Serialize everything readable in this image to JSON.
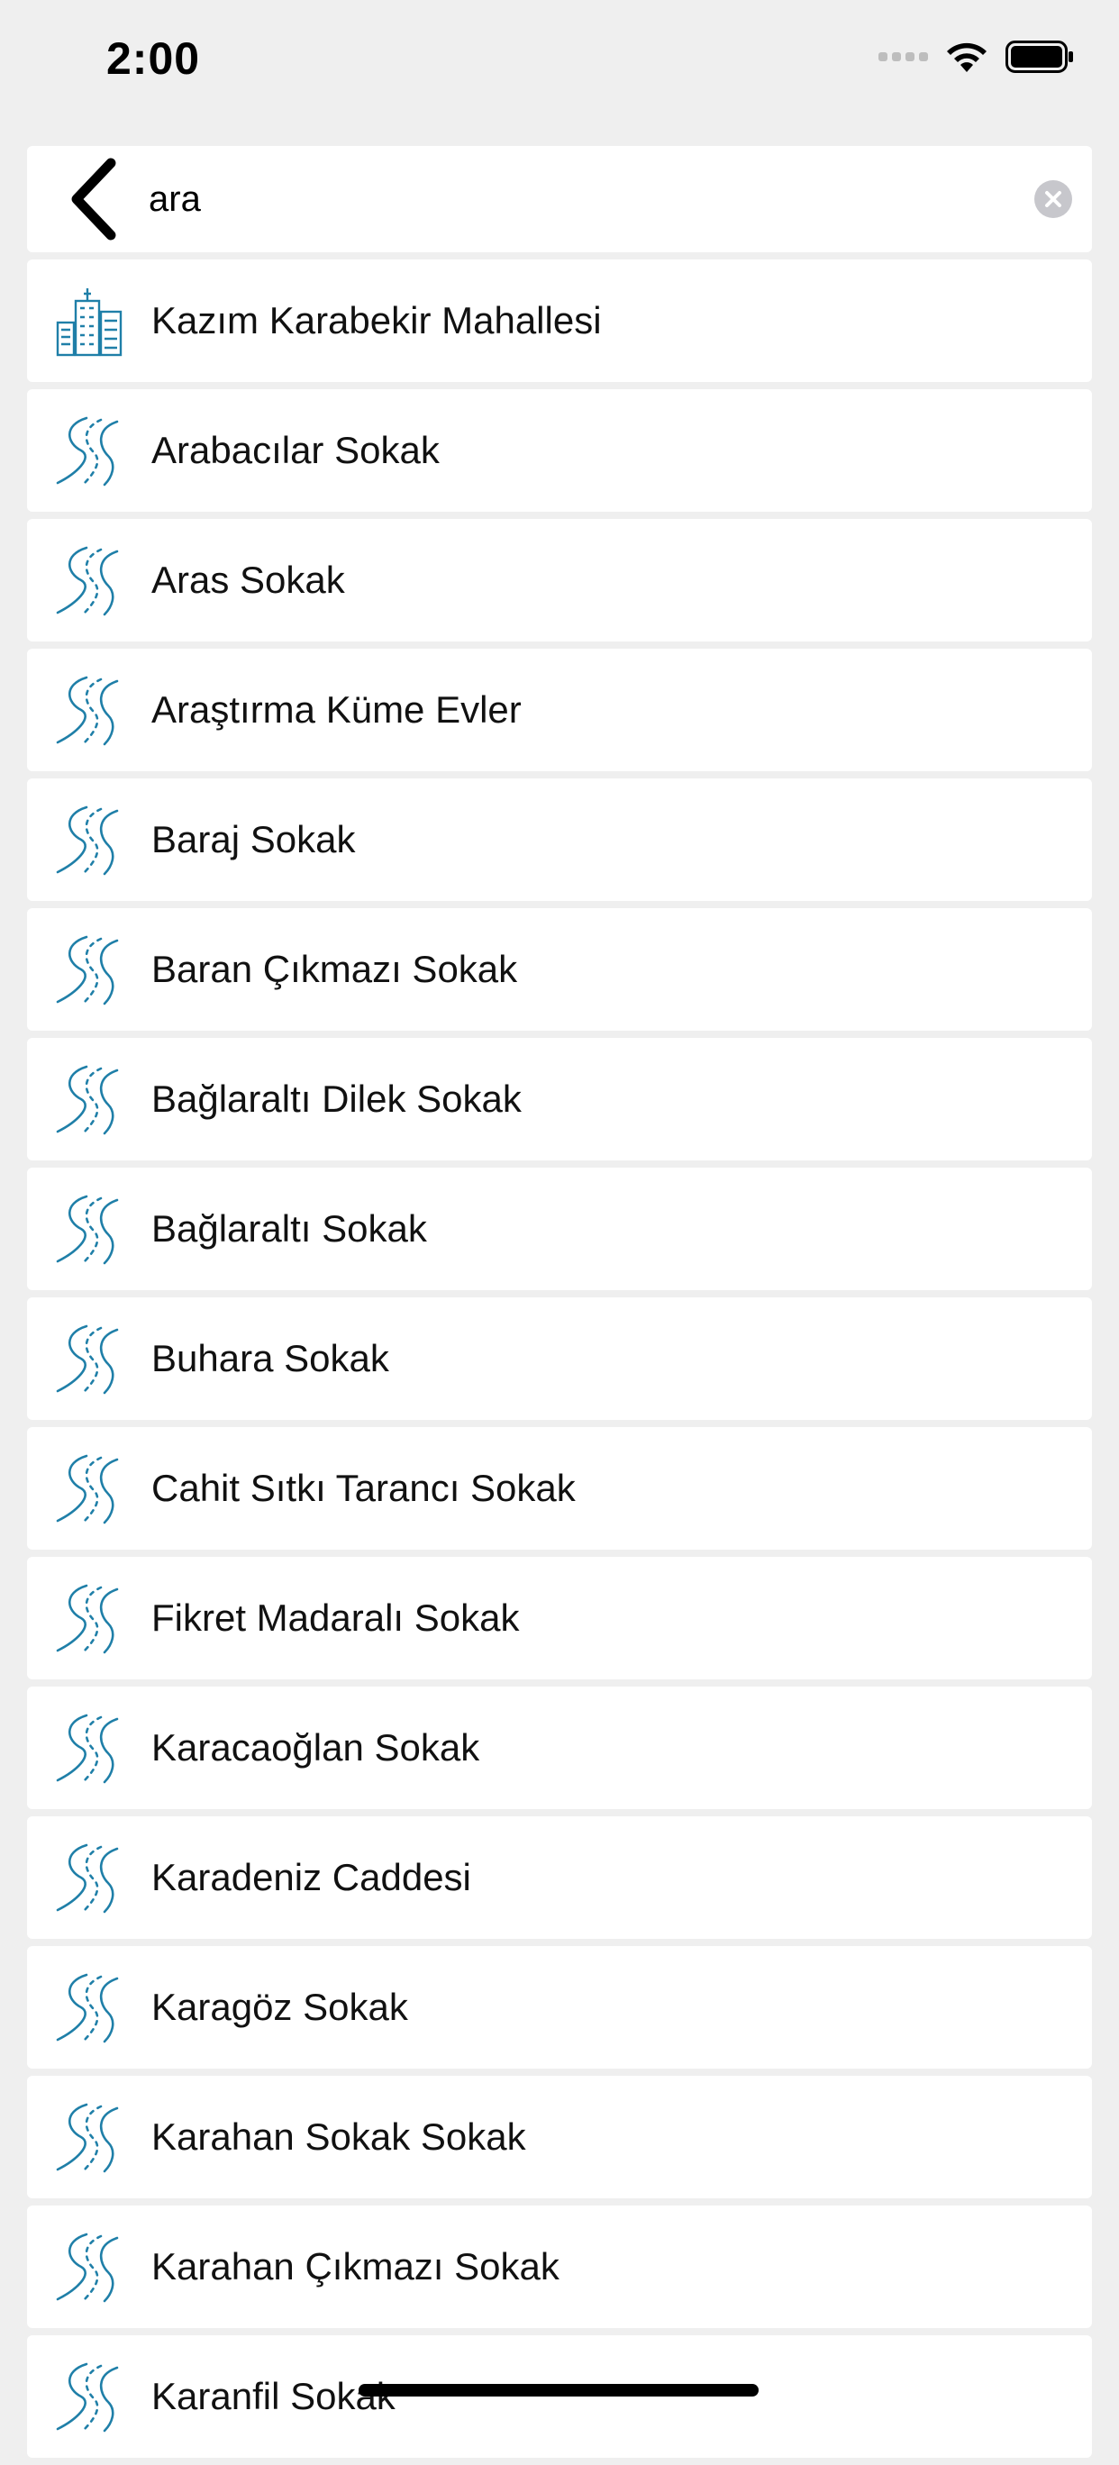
{
  "status_bar": {
    "time": "2:00"
  },
  "search": {
    "value": "ara",
    "back_icon": "chevron-left-icon",
    "clear_icon": "clear-circle-icon"
  },
  "colors": {
    "icon_accent": "#1f7fa8",
    "background": "#efefef",
    "card": "#ffffff"
  },
  "results": [
    {
      "label": "Kazım Karabekir Mahallesi",
      "icon": "building-icon"
    },
    {
      "label": "Arabacılar Sokak",
      "icon": "road-icon"
    },
    {
      "label": "Aras Sokak",
      "icon": "road-icon"
    },
    {
      "label": "Araştırma Küme Evler",
      "icon": "road-icon"
    },
    {
      "label": "Baraj Sokak",
      "icon": "road-icon"
    },
    {
      "label": "Baran Çıkmazı Sokak",
      "icon": "road-icon"
    },
    {
      "label": "Bağlaraltı Dilek Sokak",
      "icon": "road-icon"
    },
    {
      "label": "Bağlaraltı Sokak",
      "icon": "road-icon"
    },
    {
      "label": "Buhara Sokak",
      "icon": "road-icon"
    },
    {
      "label": "Cahit Sıtkı Tarancı Sokak",
      "icon": "road-icon"
    },
    {
      "label": "Fikret Madaralı Sokak",
      "icon": "road-icon"
    },
    {
      "label": "Karacaoğlan Sokak",
      "icon": "road-icon"
    },
    {
      "label": "Karadeniz Caddesi",
      "icon": "road-icon"
    },
    {
      "label": "Karagöz Sokak",
      "icon": "road-icon"
    },
    {
      "label": "Karahan Sokak Sokak",
      "icon": "road-icon"
    },
    {
      "label": "Karahan Çıkmazı Sokak",
      "icon": "road-icon"
    },
    {
      "label": "Karanfil Sokak",
      "icon": "road-icon"
    }
  ]
}
